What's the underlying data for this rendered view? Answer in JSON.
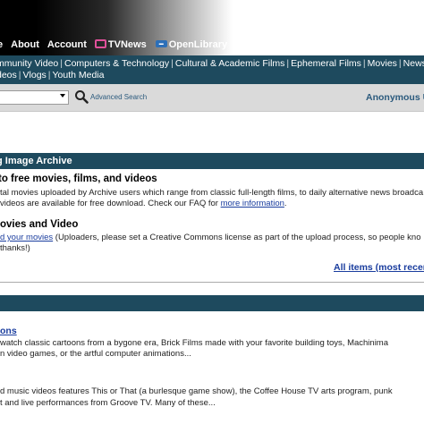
{
  "top_nav": {
    "items": [
      "e",
      "About",
      "Account"
    ],
    "tvnews": "TVNews",
    "openlibrary": "OpenLibrary"
  },
  "sub_nav": {
    "row1": [
      "mmunity Video",
      "Computers & Technology",
      "Cultural & Academic Films",
      "Ephemeral Films",
      "Movies",
      "News"
    ],
    "row2": [
      "deos",
      "Vlogs",
      "Youth Media"
    ]
  },
  "search": {
    "value": "",
    "advanced_label": "Advanced Search",
    "user_label": "Anonymous U"
  },
  "archive_section": {
    "header": "g Image Archive",
    "intro_title": " to free movies, films, and videos",
    "intro_line1": "tal movies uploaded by Archive users which range from classic full-length films, to daily alternative news broadca",
    "intro_line2_prefix": "videos are available for free download. Check our FAQ for ",
    "intro_line2_link": "more information",
    "intro_line2_suffix": ".",
    "upload_title": "ovies and Video",
    "upload_link": "d your movies",
    "upload_text": " (Uploaders, please set a Creative Commons license as part of the upload process, so people kno",
    "upload_line2": "thanks!)",
    "all_items": "All items (most recer"
  },
  "collections": {
    "item1_link": "ons",
    "item1_line1": "watch classic cartoons from a bygone era, Brick Films made with your favorite building toys, Machinima",
    "item1_line2": "n video games, or the artful computer animations...",
    "item2_line1": "d music videos features This or That (a burlesque game show), the Coffee House TV arts program, punk",
    "item2_line2": "t and live performances from Groove TV. Many of these..."
  }
}
